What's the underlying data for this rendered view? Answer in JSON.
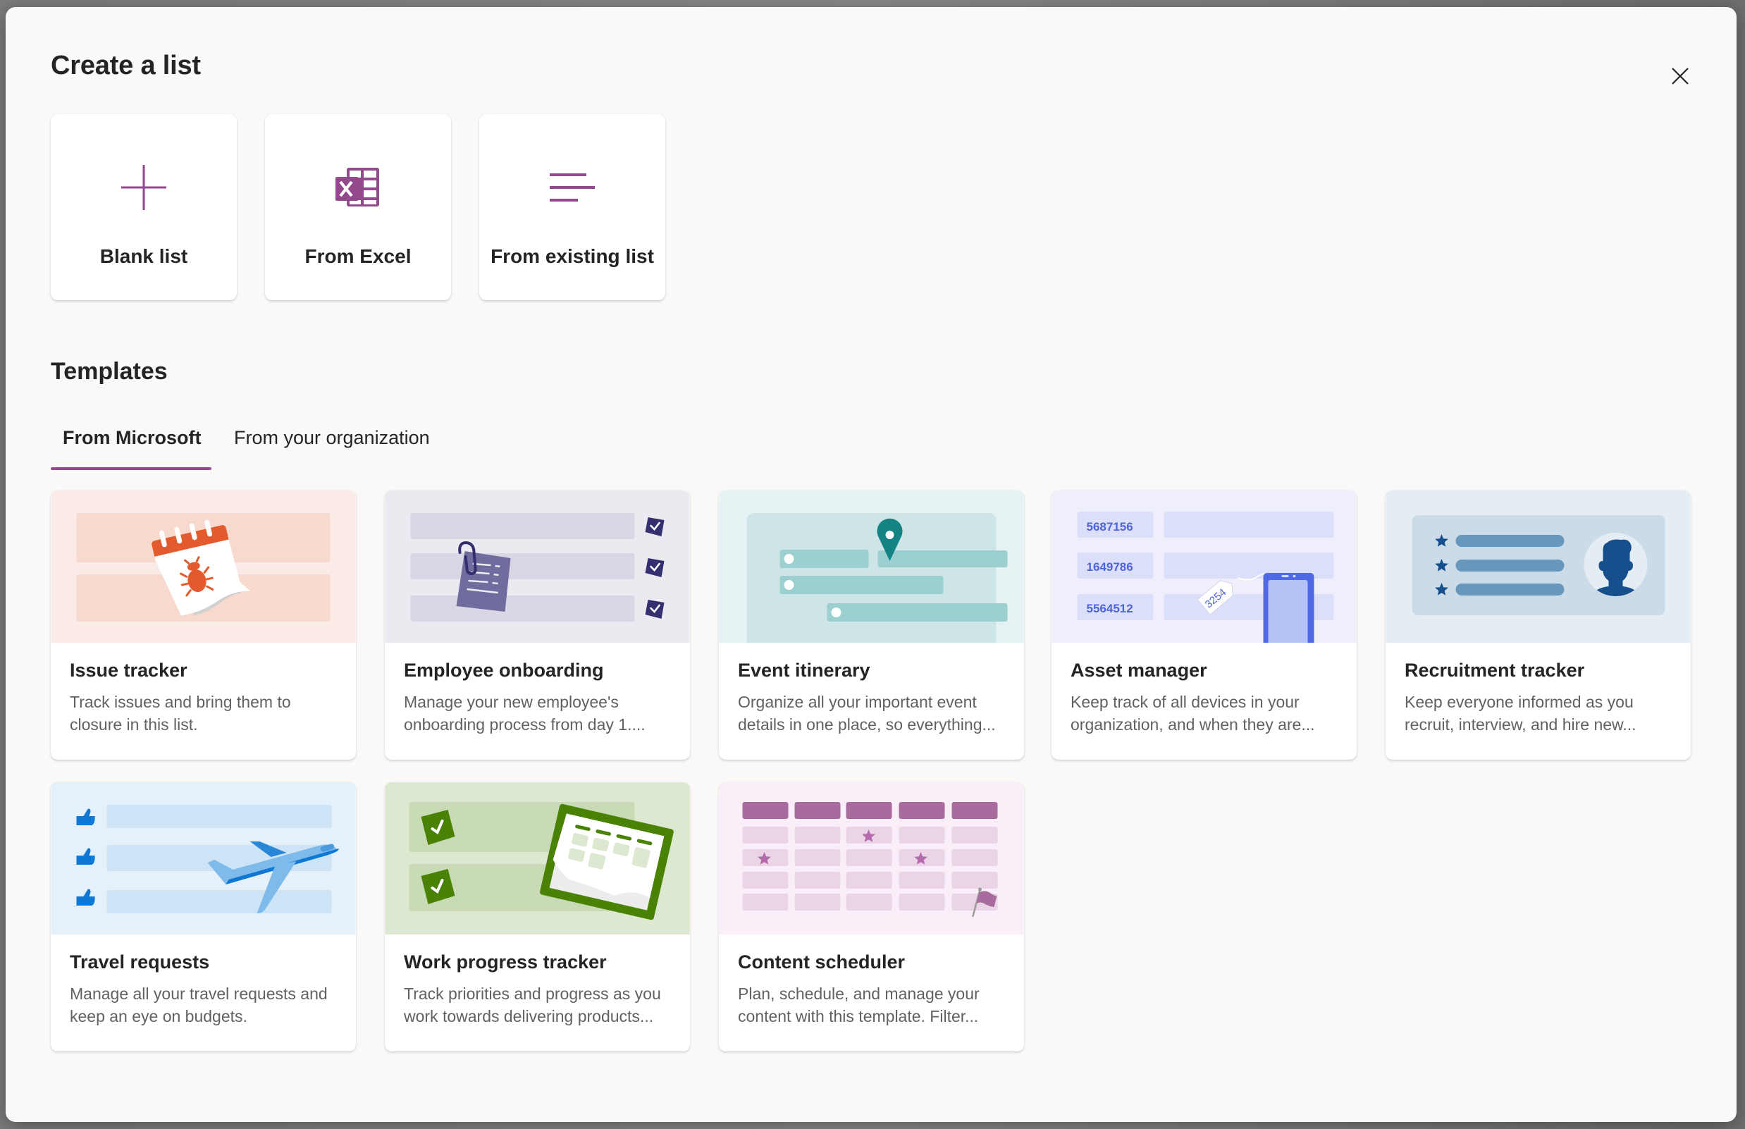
{
  "dialog": {
    "title": "Create a list",
    "close_icon": "close-icon"
  },
  "create_options": [
    {
      "label": "Blank list",
      "icon": "plus-icon"
    },
    {
      "label": "From Excel",
      "icon": "excel-icon"
    },
    {
      "label": "From existing list",
      "icon": "list-lines-icon"
    }
  ],
  "templates": {
    "heading": "Templates",
    "tabs": [
      {
        "label": "From Microsoft",
        "selected": true
      },
      {
        "label": "From your organization",
        "selected": false
      }
    ],
    "accent_color": "#924a8c",
    "items": [
      {
        "title": "Issue tracker",
        "description": "Track issues and bring them to closure in this list.",
        "icon": "bug-calendar-icon"
      },
      {
        "title": "Employee onboarding",
        "description": "Manage your new employee's onboarding process from day 1....",
        "icon": "clipboard-checklist-icon"
      },
      {
        "title": "Event itinerary",
        "description": "Organize all your important event details in one place, so everything...",
        "icon": "map-pin-icon"
      },
      {
        "title": "Asset manager",
        "description": "Keep track of all devices in your organization, and when they are...",
        "icon": "device-tag-icon",
        "art_numbers": [
          "5687156",
          "1649786",
          "5564512"
        ],
        "art_tag": "3254"
      },
      {
        "title": "Recruitment tracker",
        "description": "Keep everyone informed as you recruit, interview, and hire new...",
        "icon": "person-profile-icon"
      },
      {
        "title": "Travel requests",
        "description": "Manage all your travel requests and keep an eye on budgets.",
        "icon": "airplane-icon"
      },
      {
        "title": "Work progress tracker",
        "description": "Track priorities and progress as you work towards delivering products...",
        "icon": "progress-calendar-icon"
      },
      {
        "title": "Content scheduler",
        "description": "Plan, schedule, and manage your content with this template. Filter...",
        "icon": "schedule-grid-icon"
      }
    ]
  }
}
